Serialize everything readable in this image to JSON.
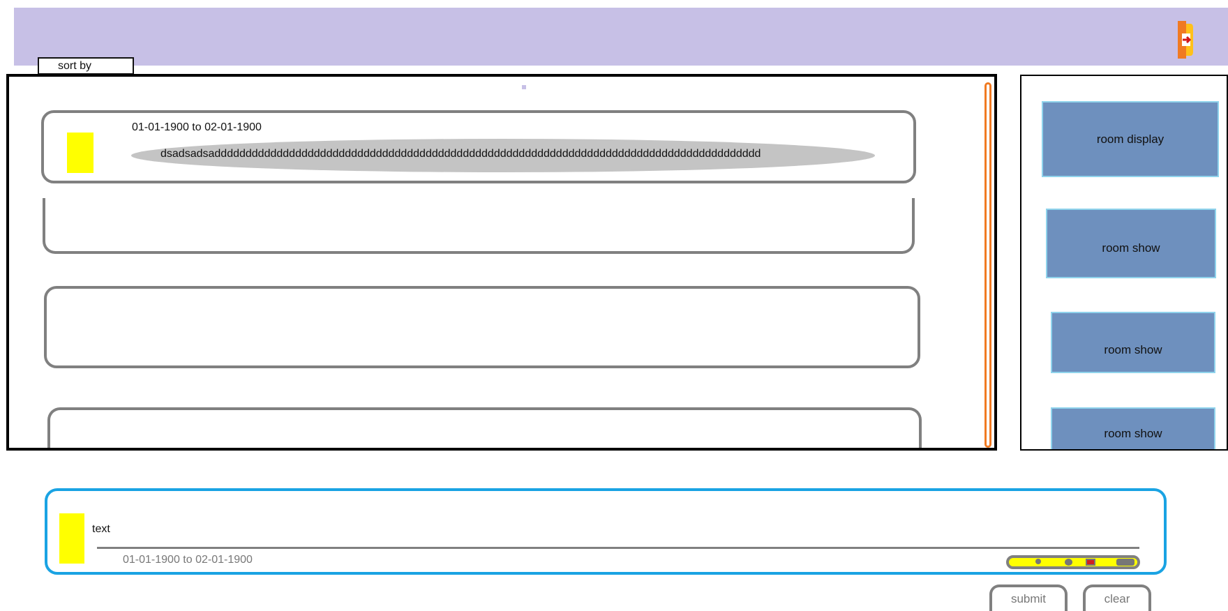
{
  "header": {
    "logout_icon": "exit-door-icon"
  },
  "sort": {
    "label": "sort by"
  },
  "list": {
    "cards": [
      {
        "date_range": "01-01-1900 to 02-01-1900",
        "text": "dsadsadsadddddddddddddddddddddddddddddddddddddddddddddddddddddddddddddddddddddddddddddddddddddddd"
      },
      {},
      {},
      {}
    ]
  },
  "rooms": {
    "buttons": [
      "room display",
      "room show",
      "room show",
      "room show"
    ]
  },
  "composer": {
    "text": "text",
    "date_range": "01-01-1900 to 02-01-1900"
  },
  "actions": {
    "submit_label": "submit",
    "clear_label": "clear"
  },
  "colors": {
    "header_bg": "#c7c0e6",
    "accent_orange": "#f07a22",
    "marker_yellow": "#ffff00",
    "room_button_bg": "#6e90be",
    "room_button_border": "#8fd3ec",
    "composer_border": "#1aa3e3",
    "pill_bg": "#c4c4c4"
  }
}
